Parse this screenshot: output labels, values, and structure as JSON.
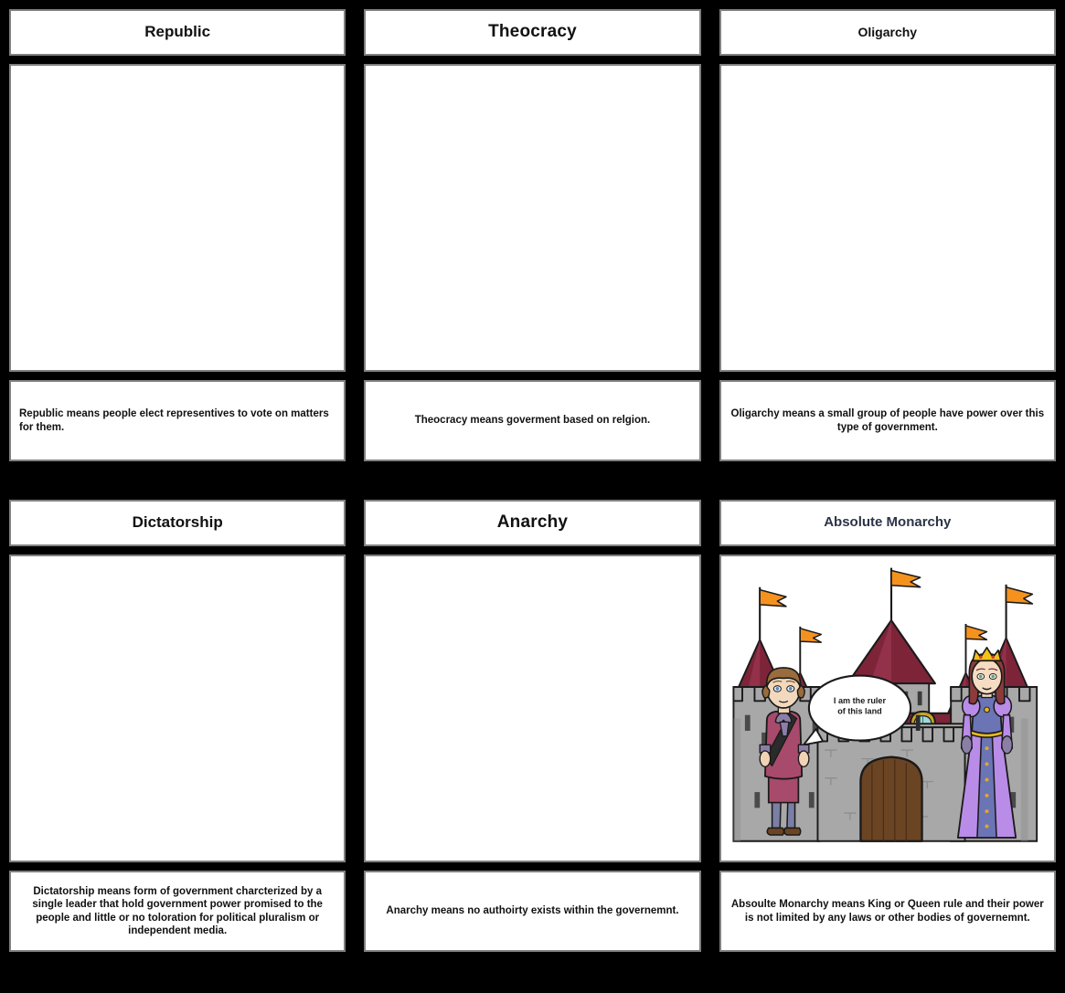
{
  "board": {
    "background_color": "#000000",
    "cell_background": "#ffffff",
    "cell_border_color": "#808080",
    "title_color": "#111111",
    "accent_navy": "#2b3347"
  },
  "cells": [
    {
      "id": "republic",
      "title": "Republic",
      "description": "Republic means people elect representives to vote on matters for them.",
      "art": "empty"
    },
    {
      "id": "theocracy",
      "title": "Theocracy",
      "description": "Theocracy means goverment based on relgion.",
      "art": "empty"
    },
    {
      "id": "oligarchy",
      "title": "Oligarchy",
      "description": "Oligarchy means a small group of people have power over this type of government.",
      "art": "empty"
    },
    {
      "id": "dictatorship",
      "title": "Dictatorship",
      "description": "Dictatorship means form of government charcterized by a single leader that hold government power promised to the people and little or no toloration for political pluralism or independent media.",
      "art": "empty"
    },
    {
      "id": "anarchy",
      "title": "Anarchy",
      "description": "Anarchy means no authoirty exists within the governemnt.",
      "art": "empty"
    },
    {
      "id": "absolute-monarchy",
      "title": "Absolute Monarchy",
      "description": "Absoulte Monarchy means King or Queen rule and their power is not limited by any laws or other bodies of governemnt.",
      "art": "castle-scene"
    }
  ],
  "scene": {
    "speech_bubble": "I am the ruler of this land",
    "characters": [
      "king-figure",
      "queen-figure"
    ],
    "colors": {
      "castle_stone": "#a8a8a8",
      "castle_stone_dark": "#8d8d8d",
      "roof_red": "#7d2439",
      "roof_red_light": "#93304a",
      "flag_orange": "#f5921e",
      "door_brown": "#6b4423",
      "king_coat": "#a84a6b",
      "queen_gown": "#b98ce8",
      "queen_panel": "#6b74b5",
      "crown_gold": "#f2c11a",
      "window_teal": "#9fd8d8"
    }
  }
}
